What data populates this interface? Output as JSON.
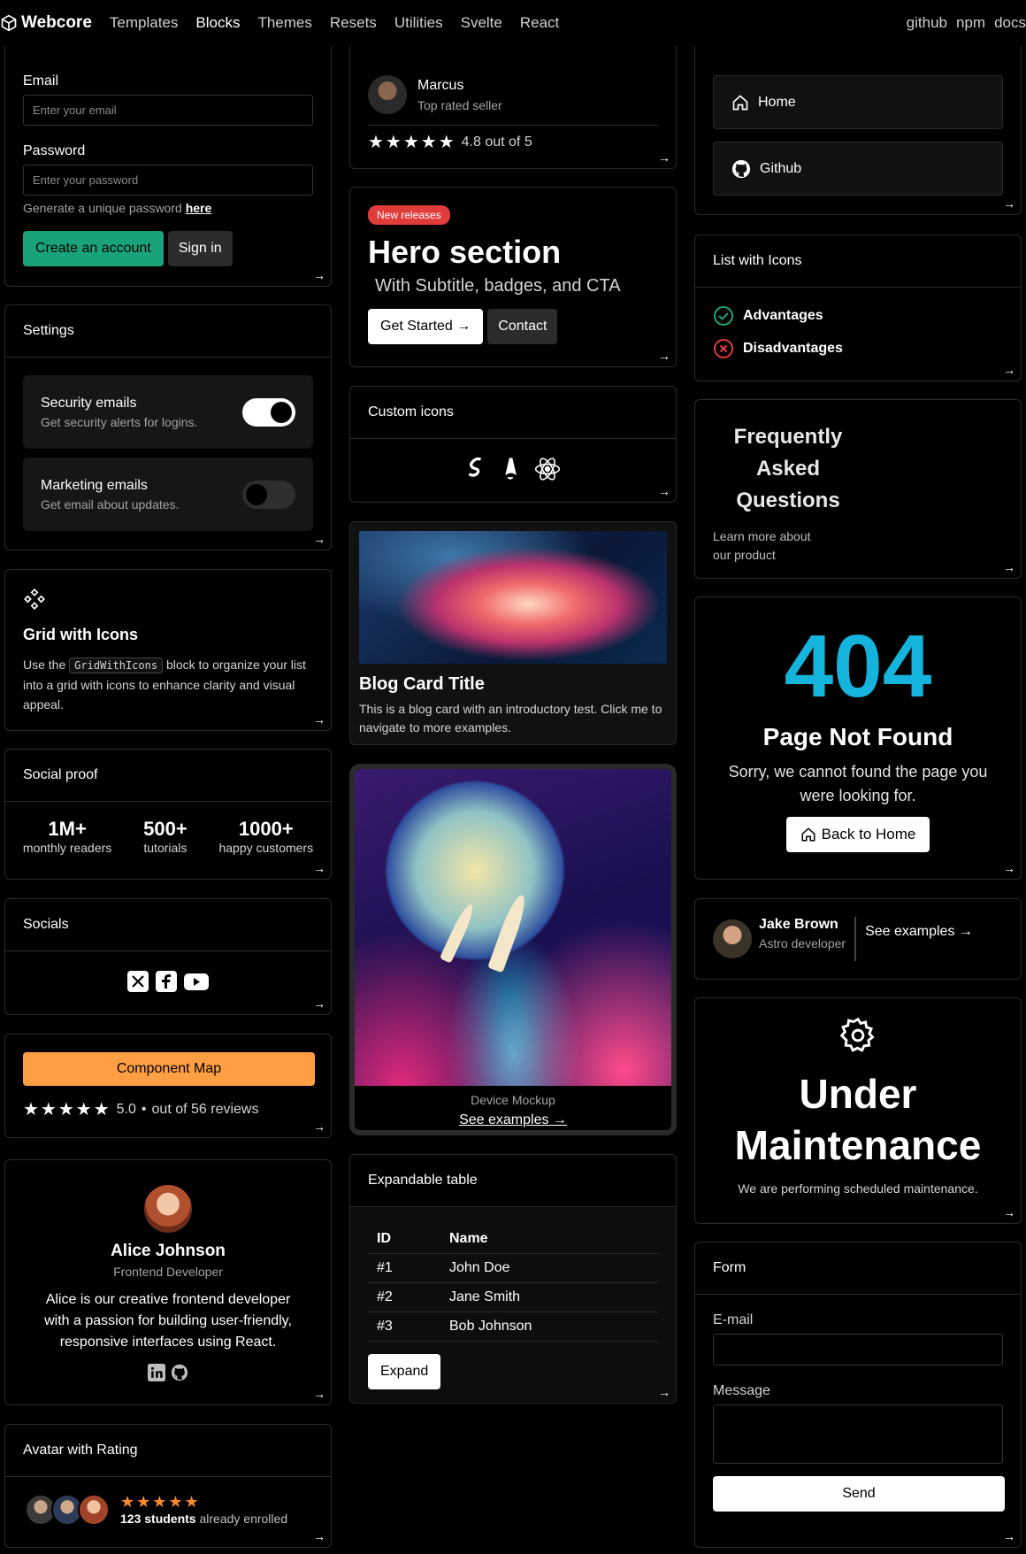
{
  "nav": {
    "brand": "Webcore",
    "links": [
      "Templates",
      "Blocks",
      "Themes",
      "Resets",
      "Utilities",
      "Svelte",
      "React"
    ],
    "right": [
      "github",
      "npm",
      "docs"
    ]
  },
  "signup": {
    "email_label": "Email",
    "email_placeholder": "Enter your email",
    "password_label": "Password",
    "password_placeholder": "Enter your password",
    "hint_prefix": "Generate a unique password",
    "hint_link": "here",
    "create_btn": "Create an account",
    "signin_btn": "Sign in"
  },
  "settings": {
    "title": "Settings",
    "items": [
      {
        "title": "Security emails",
        "desc": "Get security alerts for logins.",
        "on": true
      },
      {
        "title": "Marketing emails",
        "desc": "Get email about updates.",
        "on": false
      }
    ]
  },
  "grid_icons": {
    "title": "Grid with Icons",
    "text_pre": "Use the",
    "code": "GridWithIcons",
    "text_post": "block to organize your list into a grid with icons to enhance clarity and visual appeal."
  },
  "social_proof": {
    "title": "Social proof",
    "stats": [
      {
        "value": "1M+",
        "label": "monthly readers"
      },
      {
        "value": "500+",
        "label": "tutorials"
      },
      {
        "value": "1000+",
        "label": "happy customers"
      }
    ]
  },
  "socials": {
    "title": "Socials"
  },
  "component_map": {
    "button": "Component Map",
    "stars": "★★★★★",
    "rating": "5.0",
    "reviews": "out of 56 reviews"
  },
  "profile": {
    "name": "Alice Johnson",
    "role": "Frontend Developer",
    "bio": "Alice is our creative frontend developer with a passion for building user-friendly, responsive interfaces using React."
  },
  "avatar_rating": {
    "title": "Avatar with Rating",
    "stars": "★★★★★",
    "count": "123 students",
    "suffix": "already enrolled"
  },
  "seller": {
    "name": "Marcus",
    "role": "Top rated seller",
    "stars": "★★★★★",
    "rating": "4.8 out of 5"
  },
  "hero": {
    "badge": "New releases",
    "title": "Hero section",
    "subtitle": "With Subtitle, badges, and CTA",
    "cta_primary": "Get Started →",
    "cta_secondary": "Contact"
  },
  "custom_icons": {
    "title": "Custom icons"
  },
  "blog": {
    "title": "Blog Card Title",
    "text": "This is a blog card with an introductory test. Click me to navigate to more examples."
  },
  "device": {
    "caption": "Device Mockup",
    "link": "See examples →"
  },
  "expandable": {
    "title": "Expandable table",
    "headers": [
      "ID",
      "Name"
    ],
    "rows": [
      [
        "#1",
        "John Doe"
      ],
      [
        "#2",
        "Jane Smith"
      ],
      [
        "#3",
        "Bob Johnson"
      ]
    ],
    "button": "Expand"
  },
  "menu": {
    "items": [
      "Home",
      "Github"
    ]
  },
  "list_icons": {
    "title": "List with Icons",
    "items": [
      "Advantages",
      "Disadvantages"
    ]
  },
  "faq": {
    "title_lines": [
      "Frequently",
      "Asked",
      "Questions"
    ],
    "sub_lines": [
      "Learn more about",
      "our product"
    ]
  },
  "not_found": {
    "code": "404",
    "title": "Page Not Found",
    "text": "Sorry, we cannot found the page you were looking for.",
    "button": "Back to Home"
  },
  "author": {
    "name": "Jake Brown",
    "role": "Astro developer",
    "link": "See examples →"
  },
  "maintenance": {
    "title_lines": [
      "Under",
      "Maintenance"
    ],
    "text": "We are performing scheduled maintenance."
  },
  "form": {
    "title": "Form",
    "email_label": "E-mail",
    "message_label": "Message",
    "send": "Send"
  },
  "colors": {
    "green": "#1aa37a",
    "orange": "#ff9f43",
    "cyan": "#14b4dc",
    "red": "#e13c3c",
    "star_orange": "#ff8a2b"
  }
}
